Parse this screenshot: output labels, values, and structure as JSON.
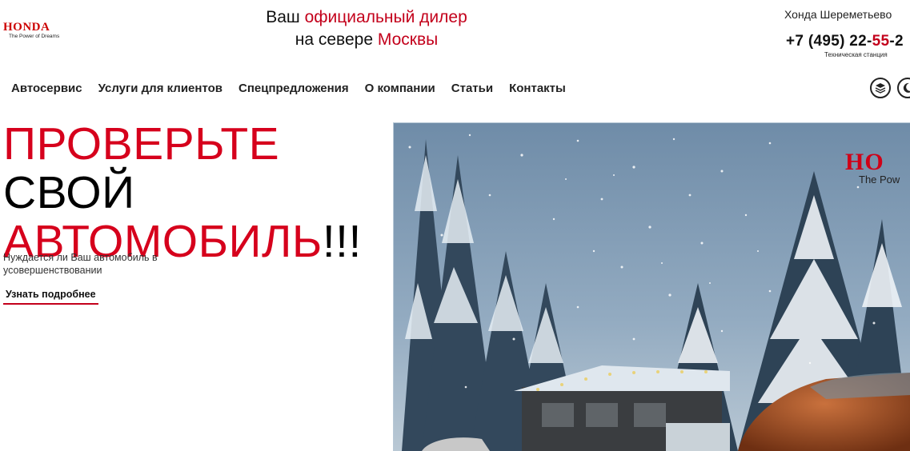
{
  "header": {
    "logo_word": "HONDA",
    "logo_tagline": "The Power of Dreams",
    "tagline_line1_a": "Ваш ",
    "tagline_line1_b": "официальный дилер",
    "tagline_line2_a": "на севере ",
    "tagline_line2_b": "Москвы",
    "dealer_name": "Хонда Шереметьево",
    "phone_a": "+7 (495) 22-",
    "phone_b": "55",
    "phone_c": "-2",
    "phone_caption": "Техническая станция"
  },
  "nav": {
    "items": [
      "Автосервис",
      "Услуги для клиентов",
      "Спецпредложения",
      "О компании",
      "Статьи",
      "Контакты"
    ]
  },
  "header_icons": [
    "layers-icon",
    "moon-icon"
  ],
  "hero": {
    "headline_red_1": "ПРОВЕРЬТЕ",
    "headline_black_1": " СВОЙ",
    "headline_red_2": "АВТОМОБИЛЬ",
    "headline_black_2": "!!!",
    "description": "Нуждается ли Ваш автомобиль в усовершенствовании",
    "more_link": "Узнать подробнее",
    "image_logo_word": "HO",
    "image_logo_tagline": "The Pow"
  },
  "colors": {
    "brand_red": "#c3001b",
    "text": "#111111",
    "sky": "#7f9ab3"
  }
}
